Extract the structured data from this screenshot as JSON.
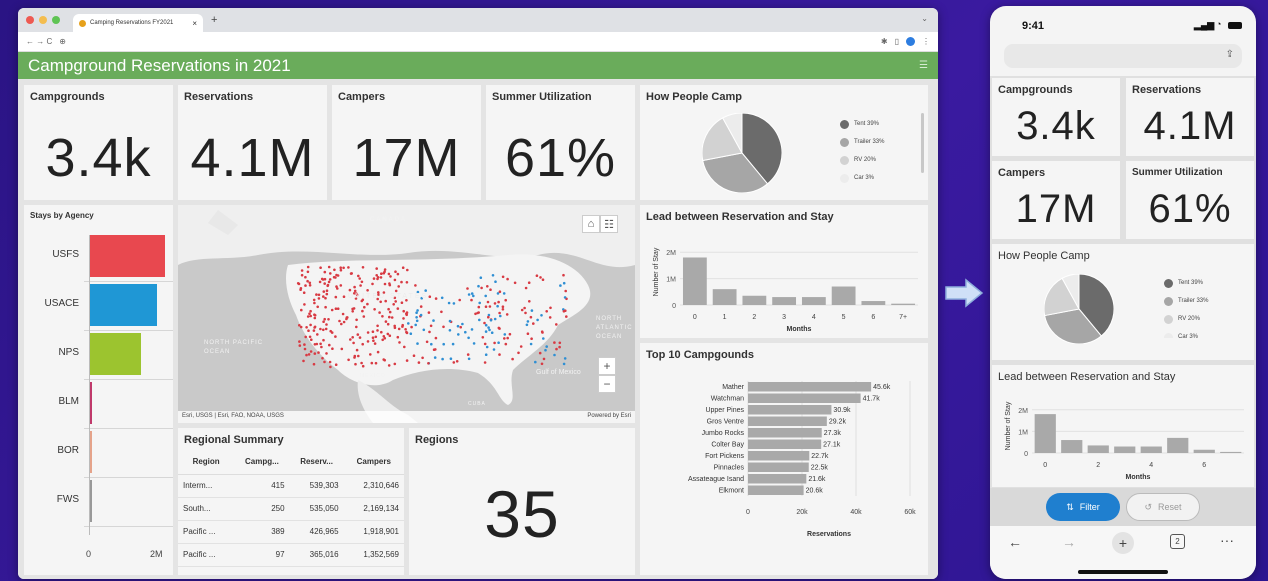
{
  "browser": {
    "tab_title": "Camping Reservations FY2021",
    "new_tab": "+",
    "nav": "← → C",
    "app_title": "Campground Reservations in 2021",
    "menu_icon": "menu-icon"
  },
  "kpis": [
    {
      "title": "Campgrounds",
      "value": "3.4k"
    },
    {
      "title": "Reservations",
      "value": "4.1M"
    },
    {
      "title": "Campers",
      "value": "17M"
    },
    {
      "title": "Summer Utilization",
      "value": "61%"
    }
  ],
  "how_people_camp": {
    "title": "How People Camp",
    "legend": [
      "Tent 39%",
      "Trailer 33%",
      "RV 20%",
      "Car 3%"
    ],
    "colors": [
      "#6b6b6b",
      "#a6a6a6",
      "#d2d2d2",
      "#ececec"
    ],
    "shares": [
      0.39,
      0.33,
      0.2,
      0.08
    ]
  },
  "stays_by_agency": {
    "title": "Stays by Agency",
    "agencies": [
      "USFS",
      "USACE",
      "NPS",
      "BLM",
      "BOR",
      "FWS"
    ],
    "values": [
      1.9,
      1.7,
      1.3,
      0.02,
      0.01,
      0.005
    ],
    "colors": [
      "#e8484f",
      "#1f97d5",
      "#9cc42f",
      "#c0396b",
      "#e5a38a",
      "#999999"
    ],
    "x_ticks": [
      "0",
      "2M"
    ],
    "xmax": 2.4
  },
  "map": {
    "labels": [
      "CANADA",
      "UNITED STATES",
      "NORTH PACIFIC OCEAN",
      "NORTH ATLANTIC OCEAN",
      "Gulf of Mexico",
      "MEXICO",
      "CUBA"
    ],
    "attribution": "Esri, USGS | Esri, FAO, NOAA, USGS",
    "powered": "Powered by Esri",
    "home_icon": "home-icon",
    "list_icon": "list-icon",
    "zoom_in": "+",
    "zoom_out": "−"
  },
  "lead": {
    "title": "Lead between Reservation and Stay",
    "ylabel": "Number of Stay",
    "xlabel": "Months",
    "y_ticks": [
      "2M",
      "1M",
      "0"
    ],
    "categories": [
      "0",
      "1",
      "2",
      "3",
      "4",
      "5",
      "6",
      "7+"
    ],
    "values": [
      1.8,
      0.6,
      0.35,
      0.3,
      0.3,
      0.7,
      0.15,
      0.05
    ],
    "ymax": 2.5
  },
  "top10": {
    "title": "Top 10 Campgounds",
    "names": [
      "Mather",
      "Watchman",
      "Upper Pines",
      "Gros Ventre",
      "Jumbo Rocks",
      "Colter Bay",
      "Fort Pickens",
      "Pinnacles",
      "Assateague Isand",
      "Elkmont"
    ],
    "values": [
      45.6,
      41.7,
      30.9,
      29.2,
      27.3,
      27.1,
      22.7,
      22.5,
      21.6,
      20.6
    ],
    "labels": [
      "45.6k",
      "41.7k",
      "30.9k",
      "29.2k",
      "27.3k",
      "27.1k",
      "22.7k",
      "22.5k",
      "21.6k",
      "20.6k"
    ],
    "x_ticks": [
      "0",
      "20k",
      "40k",
      "60k"
    ],
    "xmax": 60,
    "xlabel": "Reservations"
  },
  "regional": {
    "title": "Regional Summary",
    "columns": [
      "Region",
      "Campg...",
      "Reserv...",
      "Campers"
    ],
    "rows": [
      [
        "Interm...",
        "415",
        "539,303",
        "2,310,646"
      ],
      [
        "South...",
        "250",
        "535,050",
        "2,169,134"
      ],
      [
        "Pacific ...",
        "389",
        "426,965",
        "1,918,901"
      ],
      [
        "Pacific ...",
        "97",
        "365,016",
        "1,352,569"
      ]
    ]
  },
  "regions": {
    "title": "Regions",
    "value": "35"
  },
  "phone": {
    "time": "9:41",
    "lead_categories": [
      "0",
      "2",
      "4",
      "6"
    ],
    "filter": "Filter",
    "reset": "Reset",
    "tab_count": "2",
    "more": "···"
  }
}
